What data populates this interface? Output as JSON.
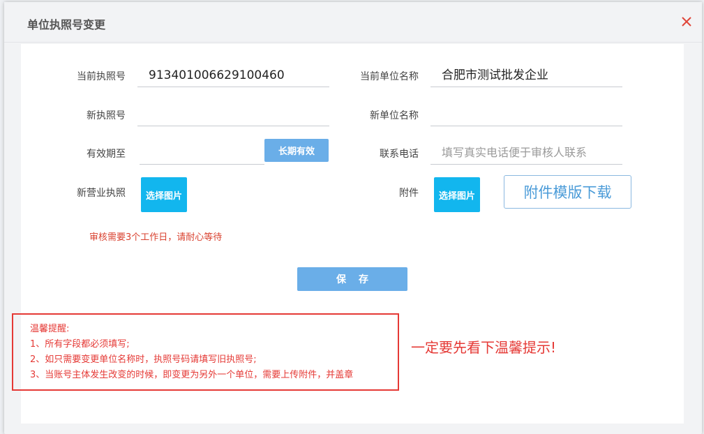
{
  "dialog": {
    "title": "单位执照号变更"
  },
  "form": {
    "current_license_label": "当前执照号",
    "current_license_value": "913401006629100460",
    "current_unit_label": "当前单位名称",
    "current_unit_value": "合肥市测试批发企业",
    "new_license_label": "新执照号",
    "new_license_value": "",
    "new_unit_label": "新单位名称",
    "new_unit_value": "",
    "valid_until_label": "有效期至",
    "valid_until_value": "",
    "long_term_button": "长期有效",
    "phone_label": "联系电话",
    "phone_placeholder": "填写真实电话便于审核人联系",
    "new_license_image_label": "新营业执照",
    "choose_image_button": "选择图片",
    "attachment_label": "附件",
    "attachment_choose_button": "选择图片",
    "template_download_button": "附件模版下载",
    "review_notice": "审核需要3个工作日，请耐心等待",
    "save_button": "保存"
  },
  "tips": {
    "title": "温馨提醒:",
    "items": [
      "1、所有字段都必须填写;",
      "2、如只需要变更单位名称时，执照号码请填写旧执照号;",
      "3、当账号主体发生改变的时候，即变更为另外一个单位，需要上传附件，并盖章"
    ]
  },
  "annotation": {
    "text": "一定要先看下温馨提示!"
  },
  "colors": {
    "primary_button": "#6aaee8",
    "image_button": "#12b6ee",
    "warning_red": "#e53935"
  }
}
